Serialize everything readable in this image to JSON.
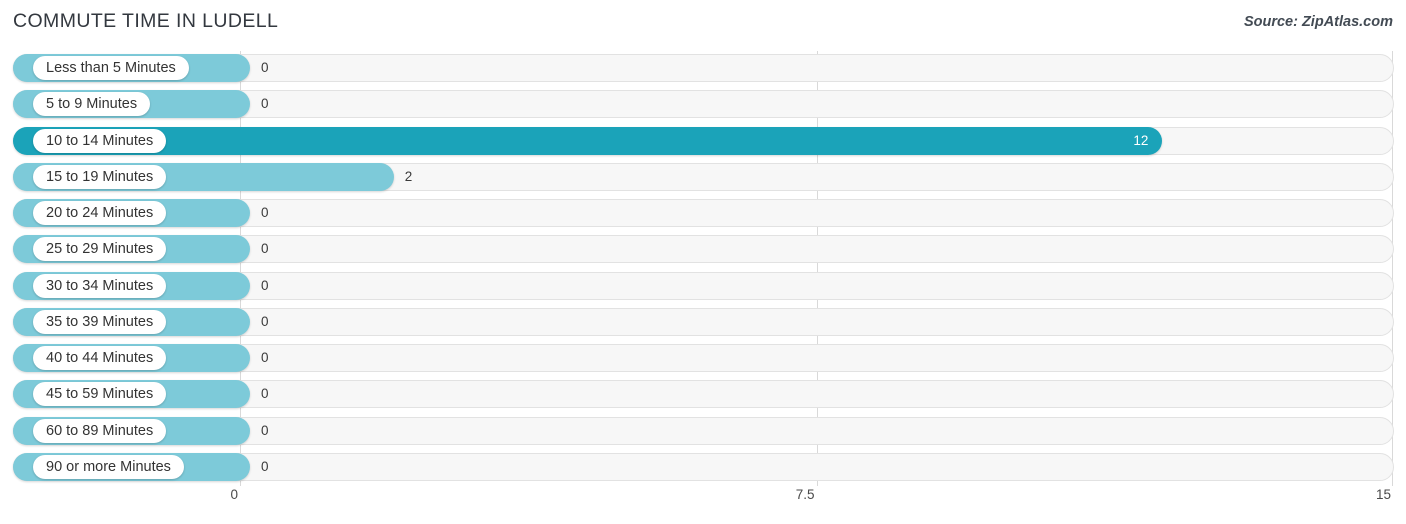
{
  "header": {
    "title": "COMMUTE TIME IN LUDELL",
    "source": "Source: ZipAtlas.com"
  },
  "colors": {
    "bar": "#7dcad9",
    "bar_max": "#1ba3b9",
    "track": "#f7f7f7",
    "grid": "#d9d9d9",
    "title": "#33383f"
  },
  "chart_data": {
    "type": "bar",
    "orientation": "horizontal",
    "title": "COMMUTE TIME IN LUDELL",
    "xlabel": "",
    "ylabel": "",
    "xlim": [
      0,
      15
    ],
    "xticks": [
      "0",
      "7.5",
      "15"
    ],
    "xtick_values": [
      0,
      7.5,
      15
    ],
    "grid": true,
    "legend": false,
    "categories": [
      "Less than 5 Minutes",
      "5 to 9 Minutes",
      "10 to 14 Minutes",
      "15 to 19 Minutes",
      "20 to 24 Minutes",
      "25 to 29 Minutes",
      "30 to 34 Minutes",
      "35 to 39 Minutes",
      "40 to 44 Minutes",
      "45 to 59 Minutes",
      "60 to 89 Minutes",
      "90 or more Minutes"
    ],
    "values": [
      0,
      0,
      12,
      2,
      0,
      0,
      0,
      0,
      0,
      0,
      0,
      0
    ],
    "value_labels": [
      "0",
      "0",
      "12",
      "2",
      "0",
      "0",
      "0",
      "0",
      "0",
      "0",
      "0",
      "0"
    ],
    "max_value": 12,
    "max_category": "10 to 14 Minutes"
  }
}
